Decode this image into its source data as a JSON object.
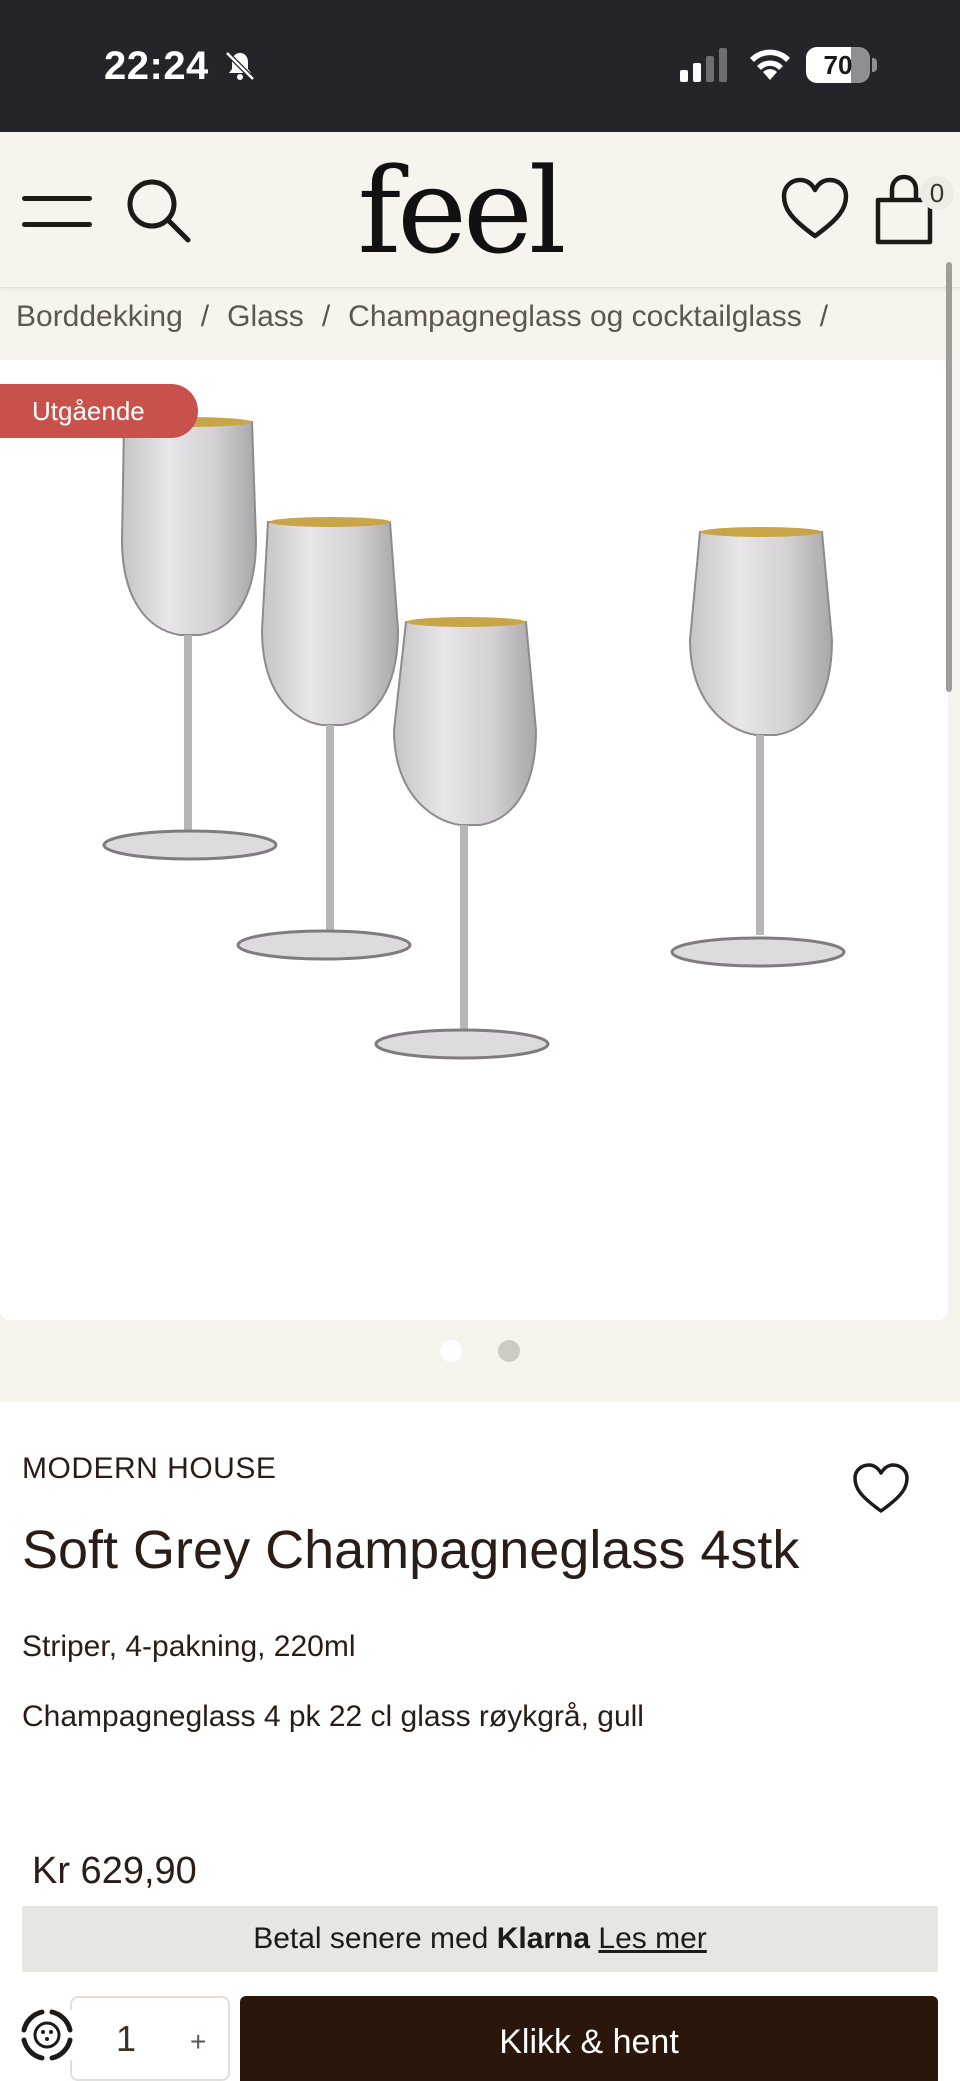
{
  "status_bar": {
    "time": "22:24",
    "battery": "70",
    "battery_level_percent": 70
  },
  "header": {
    "logo": "feel",
    "cart_count": "0",
    "icons": [
      "menu-icon",
      "search-icon",
      "heart-icon",
      "cart-icon"
    ]
  },
  "breadcrumb": {
    "items": [
      "Borddekking",
      "Glass",
      "Champagneglass og cocktailglass"
    ],
    "separator": "/"
  },
  "gallery": {
    "badge": "Utgående",
    "badge_color": "#c9514c",
    "total_images": 2,
    "active_image": 1
  },
  "product": {
    "brand": "MODERN HOUSE",
    "title": "Soft Grey Champagneglass 4stk",
    "subtitle": "Striper, 4-pakning, 220ml",
    "description": "Champagneglass 4 pk 22 cl glass røykgrå, gull",
    "price": "Kr 629,90"
  },
  "klarna": {
    "prefix": "Betal senere med",
    "brand": "Klarna",
    "link": "Les mer"
  },
  "purchase": {
    "quantity": "1",
    "plus": "+",
    "cta": "Klikk & hent",
    "cta_color": "#2b160c"
  }
}
